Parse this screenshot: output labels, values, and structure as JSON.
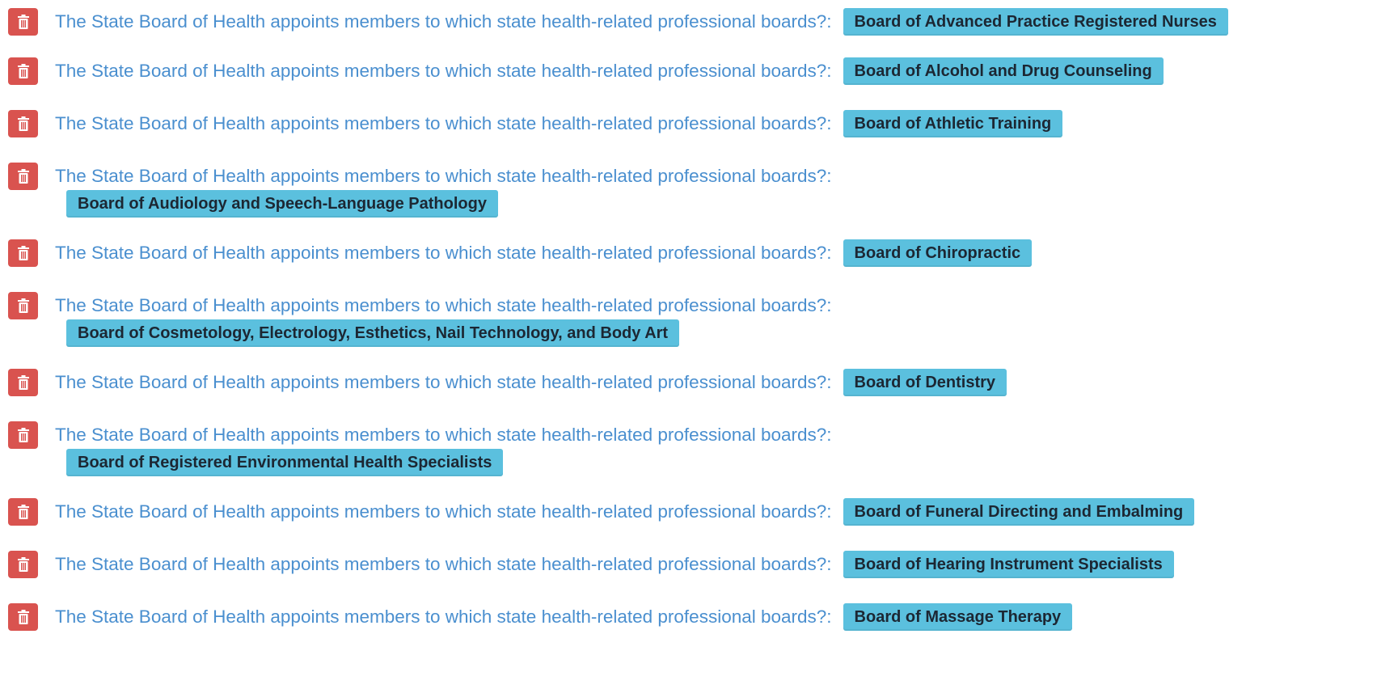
{
  "colors": {
    "delete_button": "#d9534f",
    "question_text": "#4a8fcf",
    "answer_badge_bg": "#5bc0de",
    "answer_badge_text": "#1c2733"
  },
  "icons": {
    "delete": "trash-icon"
  },
  "items": [
    {
      "question": "The State Board of Health appoints members to which state health-related professional boards?:",
      "answer": "Board of Advanced Practice Registered Nurses"
    },
    {
      "question": "The State Board of Health appoints members to which state health-related professional boards?:",
      "answer": "Board of Alcohol and Drug Counseling"
    },
    {
      "question": "The State Board of Health appoints members to which state health-related professional boards?:",
      "answer": "Board of Athletic Training"
    },
    {
      "question": "The State Board of Health appoints members to which state health-related professional boards?:",
      "answer": "Board of Audiology and Speech-Language Pathology"
    },
    {
      "question": "The State Board of Health appoints members to which state health-related professional boards?:",
      "answer": "Board of Chiropractic"
    },
    {
      "question": "The State Board of Health appoints members to which state health-related professional boards?:",
      "answer": "Board of Cosmetology, Electrology, Esthetics, Nail Technology, and Body Art"
    },
    {
      "question": "The State Board of Health appoints members to which state health-related professional boards?:",
      "answer": "Board of Dentistry"
    },
    {
      "question": "The State Board of Health appoints members to which state health-related professional boards?:",
      "answer": "Board of Registered Environmental Health Specialists"
    },
    {
      "question": "The State Board of Health appoints members to which state health-related professional boards?:",
      "answer": "Board of Funeral Directing and Embalming"
    },
    {
      "question": "The State Board of Health appoints members to which state health-related professional boards?:",
      "answer": "Board of Hearing Instrument Specialists"
    },
    {
      "question": "The State Board of Health appoints members to which state health-related professional boards?:",
      "answer": "Board of Massage Therapy"
    }
  ]
}
